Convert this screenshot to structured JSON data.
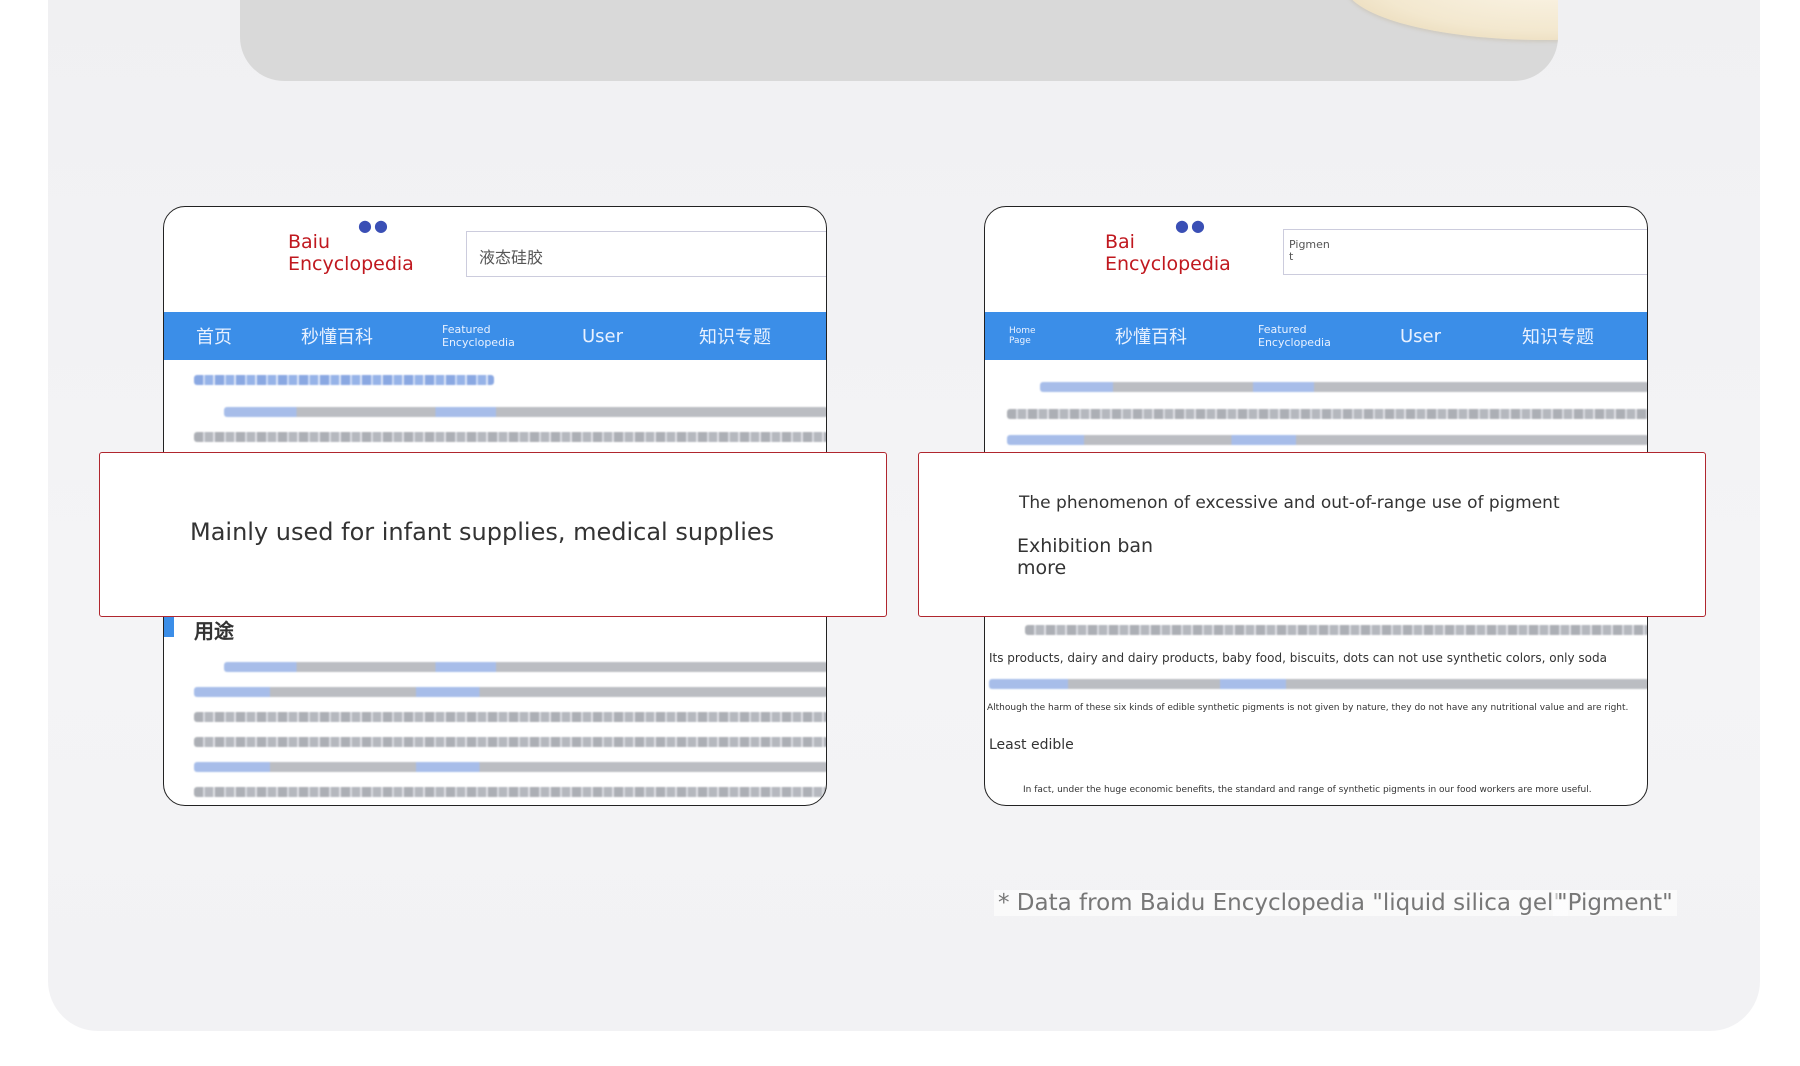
{
  "left_screen": {
    "brand_line1": "Baiu",
    "brand_line2": "Encyclopedia",
    "search_value": "液态硅胶",
    "nav": {
      "home": "首页",
      "second": "秒懂百科",
      "featured_line1": "Featured",
      "featured_line2": "Encyclopedia",
      "user": "User",
      "topics": "知识专题"
    },
    "section_heading": "用途"
  },
  "left_callout": {
    "text": "Mainly used for infant supplies, medical supplies"
  },
  "right_screen": {
    "brand_line1": "Bai",
    "brand_line2": "Encyclopedia",
    "search_line1": "Pigmen",
    "search_line2": "t",
    "nav": {
      "home_line1": "Home",
      "home_line2": "Page",
      "second": "秒懂百科",
      "featured_line1": "Featured",
      "featured_line2": "Encyclopedia",
      "user": "User",
      "topics": "知识专题"
    },
    "line_products": "Its products, dairy and dairy products, baby food, biscuits, dots can not use synthetic colors, only soda",
    "line_harm": "Although the harm of these six kinds of edible synthetic pigments is not given by nature, they do not have any nutritional value and are right.",
    "line_least": "Least edible",
    "line_fact": "In fact, under the huge economic benefits, the standard and range of synthetic pigments in our food workers are more useful."
  },
  "right_callout": {
    "line1": "The phenomenon of excessive and out-of-range use of pigment",
    "line2a": "Exhibition ban",
    "line2b": "more"
  },
  "footnote": {
    "source": "* Data from Baidu Encyclopedia \"liquid silica gel\"",
    "pigment": "\"Pigment\""
  }
}
